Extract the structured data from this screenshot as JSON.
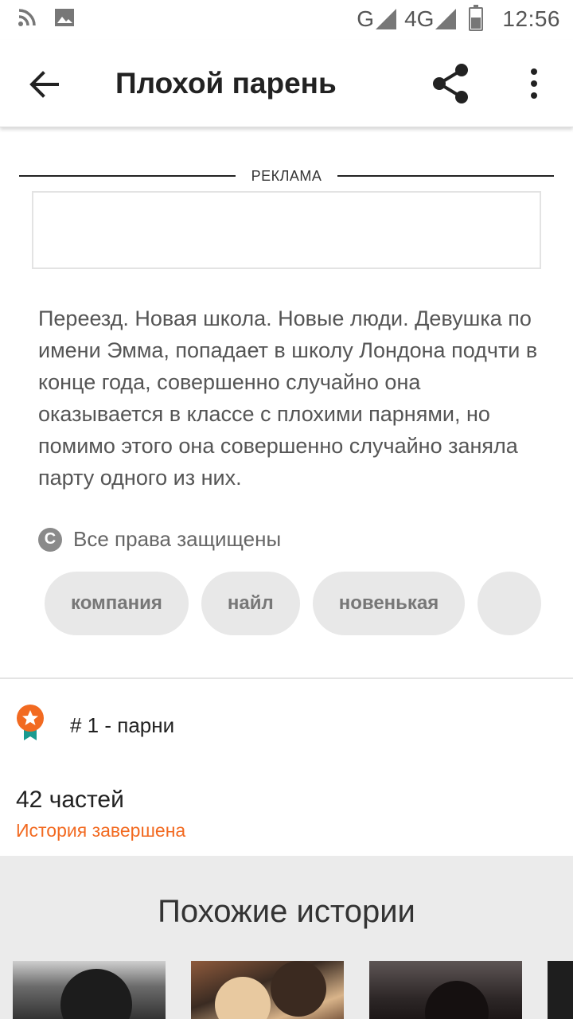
{
  "status_bar": {
    "network_g": "G",
    "network_4g": "4G",
    "time": "12:56"
  },
  "app_bar": {
    "title": "Плохой парень"
  },
  "ad": {
    "label": "РЕКЛАМА"
  },
  "description": "Переезд. Новая школа. Новые люди. Девушка по имени Эмма, попадает в школу Лондона подчти в конце года, совершенно случайно она оказывается в классе с плохими парнями, но помимо этого она совершенно случайно заняла парту одного из них.",
  "copyright": {
    "icon_letter": "C",
    "text": "Все права защищены"
  },
  "tags": [
    "компания",
    "найл",
    "новенькая",
    ""
  ],
  "ranking": {
    "text": "# 1 - парни"
  },
  "story": {
    "parts": "42 частей",
    "status": "История завершена",
    "status_color": "#f26a21"
  },
  "similar": {
    "title": "Похожие истории"
  }
}
